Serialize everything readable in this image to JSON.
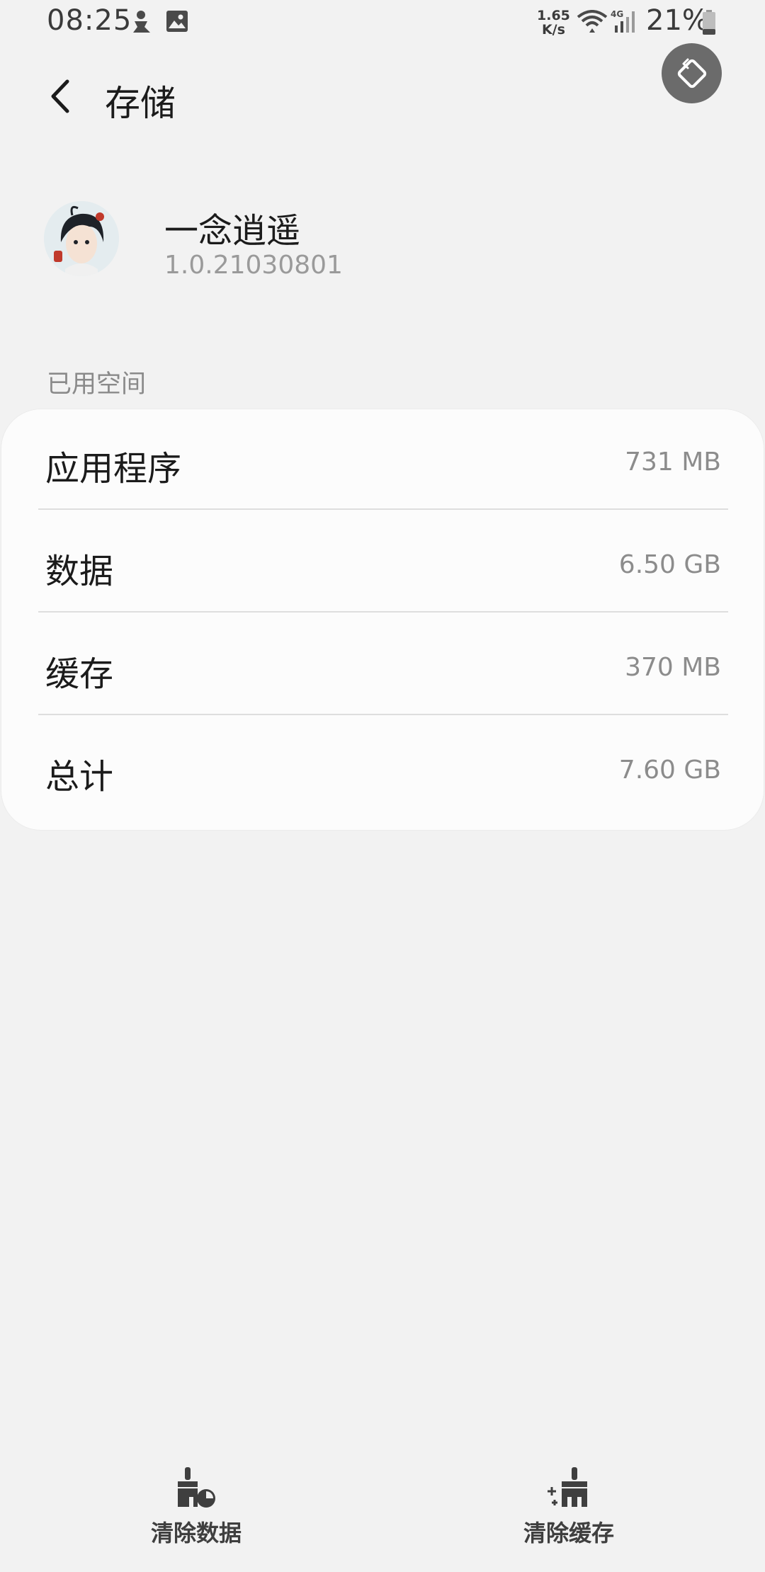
{
  "status_bar": {
    "time": "08:25",
    "net_speed_value": "1.65",
    "net_speed_unit": "K/s",
    "network_type": "4G",
    "battery": "21%"
  },
  "header": {
    "title": "存储"
  },
  "app": {
    "name": "一念逍遥",
    "version": "1.0.21030801"
  },
  "section": {
    "label": "已用空间"
  },
  "storage": [
    {
      "label": "应用程序",
      "value": "731 MB"
    },
    {
      "label": "数据",
      "value": "6.50 GB"
    },
    {
      "label": "缓存",
      "value": "370 MB"
    },
    {
      "label": "总计",
      "value": "7.60 GB"
    }
  ],
  "actions": {
    "clear_data": "清除数据",
    "clear_cache": "清除缓存"
  },
  "colors": {
    "background": "#f2f2f2",
    "card": "#fcfcfc",
    "secondary_text": "#8c8c8c"
  }
}
